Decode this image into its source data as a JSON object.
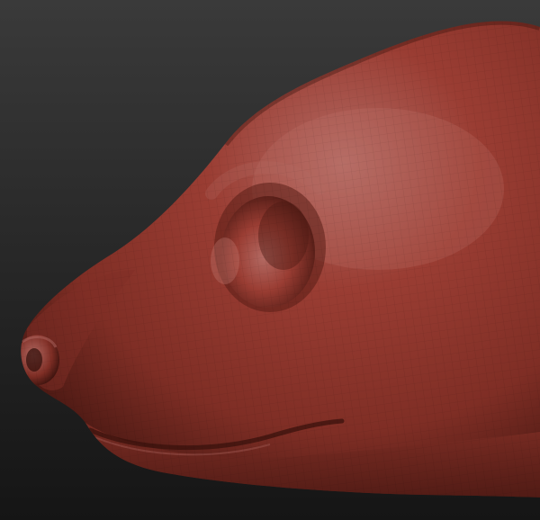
{
  "scene": {
    "subject": "sculpted-animal-head-side-view",
    "background_colors": {
      "top": "#3a3a3a",
      "bottom": "#151515"
    },
    "material_colors": {
      "highlight": "#b36a63",
      "base": "#9a3d33",
      "mid": "#7f2e25",
      "shadow": "#4e1a14",
      "deep_shadow": "#2e0d09"
    },
    "show_wireframe": true
  }
}
